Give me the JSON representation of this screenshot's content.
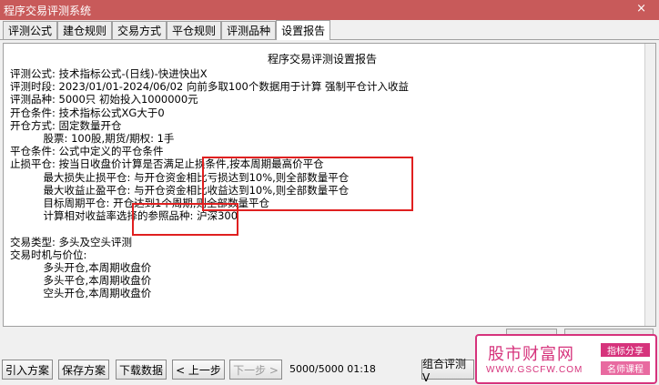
{
  "window": {
    "title": "程序交易评测系统",
    "close_glyph": "×"
  },
  "tabs": [
    {
      "label": "评测公式"
    },
    {
      "label": "建仓规则"
    },
    {
      "label": "交易方式"
    },
    {
      "label": "平仓规则"
    },
    {
      "label": "评测品种"
    },
    {
      "label": "设置报告"
    }
  ],
  "report": {
    "title": "程序交易评测设置报告",
    "lines": [
      "评测公式: 技术指标公式-(日线)-快进快出X",
      "评测时段: 2023/01/01-2024/06/02 向前多取100个数据用于计算 强制平仓计入收益",
      "评测品种: 5000只 初始投入1000000元",
      "开仓条件: 技术指标公式XG大于0",
      "开仓方式: 固定数量开仓",
      "          股票: 100股,期货/期权: 1手",
      "平仓条件: 公式中定义的平仓条件",
      "止损平仓: 按当日收盘价计算是否满足止损条件,按本周期最高价平仓",
      "          最大损失止损平仓: 与开仓资金相比亏损达到10%,则全部数量平仓",
      "          最大收益止盈平仓: 与开仓资金相比收益达到10%,则全部数量平仓",
      "          目标周期平仓: 开仓达到1个周期,则全部数量平仓",
      "          计算相对收益率选择的参照品种: 沪深300",
      "",
      "交易类型: 多头及空头评测",
      "交易时机与价位:",
      "          多头开仓,本周期收盘价",
      "          多头平仓,本周期收盘价",
      "          空头开仓,本周期收盘价"
    ]
  },
  "toolbar": {
    "import": "引入方案",
    "save": "保存方案",
    "download": "下载数据",
    "prev": "< 上一步",
    "next": "下一步 >",
    "progress": "5000/5000 01:18",
    "combo": "组合评测V"
  },
  "watermark": {
    "title": "股市财富网",
    "url": "WWW.GSCFW.COM",
    "tag1": "指标分享",
    "tag2": "名师课程",
    "color": "#d6337c"
  },
  "colors": {
    "titlebar": "#c85a5a",
    "highlight_box": "#e02020"
  }
}
